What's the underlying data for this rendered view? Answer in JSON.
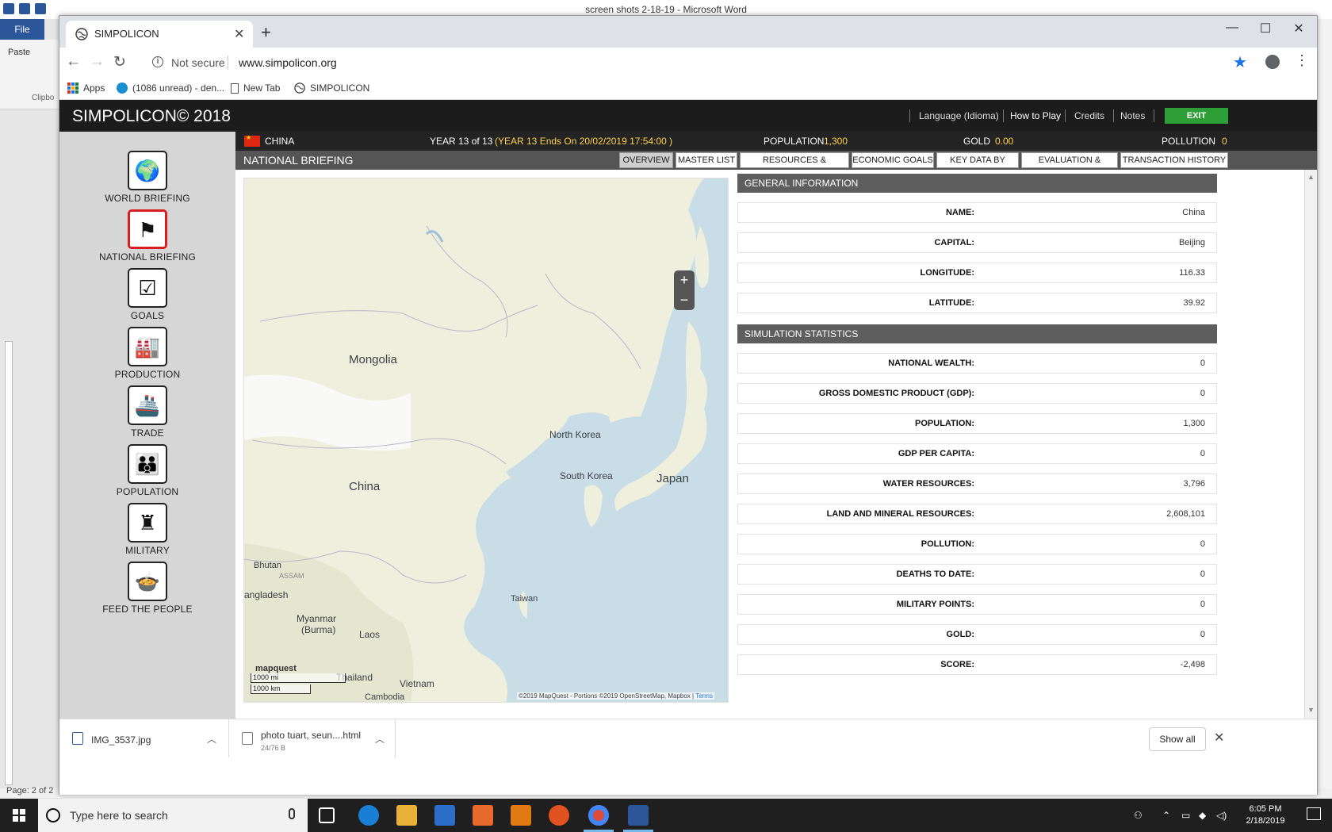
{
  "word": {
    "title": "screen shots 2-18-19  -  Microsoft Word",
    "file_label": "File",
    "paste_label": "Paste",
    "clipboard_label": "Clipbo",
    "page_status": "Page: 2 of 2"
  },
  "browser": {
    "tab_title": "SIMPOLICON",
    "not_secure": "Not secure",
    "url": "www.simpolicon.org",
    "bookmarks": [
      "Apps",
      "(1086 unread) - den...",
      "New Tab",
      "SIMPOLICON"
    ]
  },
  "app": {
    "title": "SIMPOLICON© 2018",
    "header_links": [
      "Language (Idioma)",
      "How to Play",
      "Credits",
      "Notes"
    ],
    "exit_label": "EXIT"
  },
  "sidebar": {
    "items": [
      {
        "label": "WORLD BRIEFING",
        "icon": "globe-icon",
        "glyph": "🌍",
        "active": false
      },
      {
        "label": "NATIONAL BRIEFING",
        "icon": "flag-icon",
        "glyph": "⚑",
        "active": true
      },
      {
        "label": "GOALS",
        "icon": "checklist-icon",
        "glyph": "☑",
        "active": false
      },
      {
        "label": "PRODUCTION",
        "icon": "factory-icon",
        "glyph": "🏭",
        "active": false
      },
      {
        "label": "TRADE",
        "icon": "ship-icon",
        "glyph": "🚢",
        "active": false
      },
      {
        "label": "POPULATION",
        "icon": "people-icon",
        "glyph": "👪",
        "active": false
      },
      {
        "label": "MILITARY",
        "icon": "soldiers-icon",
        "glyph": "♜",
        "active": false
      },
      {
        "label": "FEED THE PEOPLE",
        "icon": "food-bowl-icon",
        "glyph": "🍲",
        "active": false
      }
    ]
  },
  "stats": {
    "country": "CHINA",
    "year": "YEAR  13 of 13",
    "year_end": "(YEAR 13 Ends On 20/02/2019 17:54:00 )",
    "population_label": "POPULATION",
    "population_value": "1,300",
    "gold_label": "GOLD",
    "gold_value": "0.00",
    "pollution_label": "POLLUTION",
    "pollution_value": "0"
  },
  "briefing": {
    "title": "NATIONAL BRIEFING",
    "tabs": [
      {
        "label": "OVERVIEW",
        "active": true
      },
      {
        "label": "MASTER LIST",
        "active": false
      },
      {
        "label": "RESOURCES & PRODUCTS",
        "active": false
      },
      {
        "label": "ECONOMIC GOALS",
        "active": false
      },
      {
        "label": "KEY DATA BY YEAR",
        "active": false
      },
      {
        "label": "EVALUATION & SCORE",
        "active": false
      },
      {
        "label": "TRANSACTION HISTORY",
        "active": false
      }
    ]
  },
  "map": {
    "labels": [
      "Mongolia",
      "North Korea",
      "South Korea",
      "Japan",
      "China",
      "Bhutan",
      "ASSAM",
      "angladesh",
      "Myanmar",
      "(Burma)",
      "Laos",
      "Taiwan",
      "Thailand",
      "Vietnam",
      "Cambodia"
    ],
    "zoom_in": "+",
    "zoom_out": "−",
    "logo": "mapquest",
    "scale_mi": "1000 mi",
    "scale_km": "1000 km",
    "attribution": "©2019 MapQuest - Portions  ©2019 OpenStreetMap, Mapbox |",
    "terms": "Terms"
  },
  "general_info": {
    "header": "GENERAL INFORMATION",
    "rows": [
      {
        "label": "NAME:",
        "value": "China"
      },
      {
        "label": "CAPITAL:",
        "value": "Beijing"
      },
      {
        "label": "LONGITUDE:",
        "value": "116.33"
      },
      {
        "label": "LATITUDE:",
        "value": "39.92"
      }
    ]
  },
  "simulation_stats": {
    "header": "SIMULATION STATISTICS",
    "rows": [
      {
        "label": "NATIONAL WEALTH:",
        "value": "0"
      },
      {
        "label": "GROSS DOMESTIC PRODUCT (GDP):",
        "value": "0"
      },
      {
        "label": "POPULATION:",
        "value": "1,300"
      },
      {
        "label": "GDP PER CAPITA:",
        "value": "0"
      },
      {
        "label": "WATER RESOURCES:",
        "value": "3,796"
      },
      {
        "label": "LAND AND MINERAL RESOURCES:",
        "value": "2,608,101"
      },
      {
        "label": "POLLUTION:",
        "value": "0"
      },
      {
        "label": "DEATHS TO DATE:",
        "value": "0"
      },
      {
        "label": "MILITARY POINTS:",
        "value": "0"
      },
      {
        "label": "GOLD:",
        "value": "0"
      },
      {
        "label": "SCORE:",
        "value": "-2,498"
      }
    ]
  },
  "downloads": {
    "items": [
      {
        "name": "IMG_3537.jpg",
        "sub": ""
      },
      {
        "name": "photo tuart, seun....html",
        "sub": "24/76 B"
      }
    ],
    "show_all": "Show all"
  },
  "taskbar": {
    "search_placeholder": "Type here to search",
    "time": "6:05 PM",
    "date": "2/18/2019"
  },
  "colors": {
    "header_bg": "#1c1c1c",
    "exit_green": "#2e9e36",
    "active_red": "#d81e1e",
    "panel_header": "#5e5e5e",
    "gold_text": "#ffd24a"
  }
}
